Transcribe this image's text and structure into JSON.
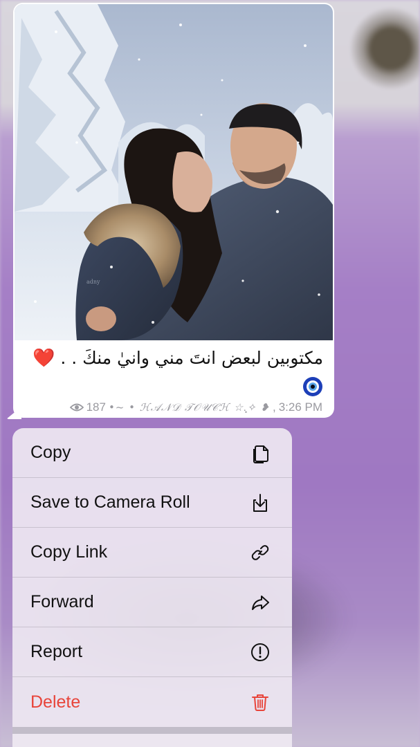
{
  "message": {
    "caption": "مكتوبين لبعض انتَ مني وانيٰ منكَ . .",
    "caption_emoji": "❤️",
    "extra_emoji": "🧿",
    "views": "187",
    "signature": "•~ • ℋ𝒜𝒩𝒟 𝒯𝒪𝒰𝒞ℋ ☆.̩͙✧ ❥",
    "time": "3:26 PM",
    "photo_watermark": "adny"
  },
  "menu": {
    "items": [
      {
        "label": "Copy",
        "icon": "copy-icon"
      },
      {
        "label": "Save to Camera Roll",
        "icon": "save-download-icon"
      },
      {
        "label": "Copy Link",
        "icon": "link-icon"
      },
      {
        "label": "Forward",
        "icon": "forward-arrow-icon"
      },
      {
        "label": "Report",
        "icon": "report-exclamation-icon"
      },
      {
        "label": "Delete",
        "icon": "trash-icon"
      }
    ]
  },
  "colors": {
    "danger": "#e8443a",
    "bubble": "#ffffff",
    "meta_text": "#9a9aa0",
    "background_purple": "#a57fc6"
  }
}
